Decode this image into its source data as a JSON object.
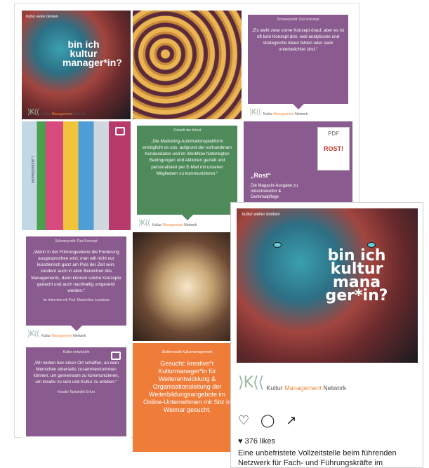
{
  "tiles": [
    {
      "id": "tile1",
      "type": "image",
      "tiny": "Kultur weiter denken",
      "title": "bin ich kultur manager*in?"
    },
    {
      "id": "tile2",
      "type": "image"
    },
    {
      "id": "tile3",
      "type": "quote",
      "head": "Schwerpunkt: Das Konzept",
      "text": "„Es steht zwar vorne Konzept drauf, aber es ist oft kein Konzept drin, weil analytische und strategische Ideen fehlen oder stark unterbelichtet sind.“"
    },
    {
      "id": "tile4",
      "type": "image",
      "banner": "Landestheater"
    },
    {
      "id": "tile5",
      "type": "quote",
      "head": "Zukunft der Arbeit",
      "text": "„Die Marketing-Automationsplattform ermöglicht es uns, aufgrund der vorhandenen Kundendaten und im Workflow hinterlegten Bedingungen und Aktionen gezielt und personalisiert per E-Mail mit unseren Mitgliedern zu kommunizieren.“"
    },
    {
      "id": "tile6",
      "type": "quote",
      "pdf": "PDF",
      "title": "„Rost“",
      "text": "Die Magazin-Ausgabe zu Industriekultur & Denkmalpflege"
    },
    {
      "id": "tile7",
      "type": "quote",
      "head": "Schwerpunkt: Das Konzept",
      "text": "„Wenn in der Führungsebene die Forderung ausgesprochen wird, man will nicht nur künstlerisch ganz am Puls der Zeit sein, sondern auch in allen Bereichen des Managements, dann können solche Konzepte gedacht und auch nachhaltig umgesetzt werden.“",
      "cap": "Im Interview mit Prof. Maximilian Lesebera"
    },
    {
      "id": "tile8",
      "type": "image"
    },
    {
      "id": "tile9",
      "type": "quote",
      "head": "Kultur entwickeln",
      "text": "„Wir wollen hier einen Ort schaffen, an dem Menschen einerseits zusammenkommen können, um gemeinsam zu kommunizieren, um kreativ zu sein und Kultur zu erleben.“",
      "cap": "Kreativ Tankstelle Erfurt"
    },
    {
      "id": "tile10",
      "type": "job",
      "head": "Stellenmarkt Kulturmanagement",
      "text": "Gesucht: kreative*r Kulturmanager*in für Weiterentwicklung & Organisationsleitung der Weiterbildungsangebote im Online-Unternehmen mit Sitz in Weimar gesucht."
    }
  ],
  "logo": {
    "mark": "⟩K⟨⟨",
    "name_a": "Kultur ",
    "name_b": "Management",
    "name_c": " Network"
  },
  "post": {
    "tiny": "kultur weiter denken",
    "title": "bin ich kultur mana ger*in?",
    "likes": "376 likes",
    "caption": "Eine unbefristete Vollzeitstelle beim führenden Netzwerk für Fach- und Führungskräfte im"
  },
  "colors": {
    "purple": "#8a5b8e",
    "green": "#4f8a5a",
    "orange": "#f07c3a"
  },
  "icons": {
    "like": "heart-outline-icon",
    "comment": "comment-icon",
    "share": "share-icon"
  }
}
